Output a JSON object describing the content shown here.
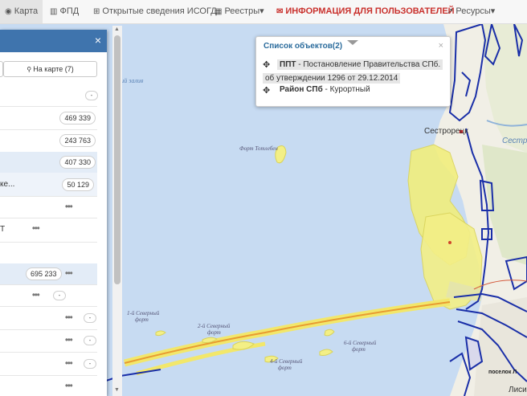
{
  "nav": {
    "items": [
      {
        "label": "Карта",
        "icon": "globe-icon",
        "active": true
      },
      {
        "label": "ФПД",
        "icon": "map-book-icon"
      },
      {
        "label": "Открытые сведения ИСОГД",
        "icon": "square-plus-icon"
      },
      {
        "label": "Реестры",
        "icon": "table-icon",
        "caret": "▾"
      },
      {
        "label": "ИНФОРМАЦИЯ ДЛЯ ПОЛЬЗОВАТЕЛЕЙ",
        "icon": "chat-icon",
        "alert": true
      },
      {
        "label": "Ресурсы",
        "icon": "external-link-icon",
        "caret": "▾"
      }
    ]
  },
  "panel": {
    "close": "×",
    "tab_map": "На карте (7)",
    "rows": [
      {
        "label": "",
        "count": "",
        "mini": "-"
      },
      {
        "label": "",
        "count": "469 339"
      },
      {
        "label": "",
        "count": "243 763"
      },
      {
        "label": "",
        "count": "407 330",
        "highlight": true
      },
      {
        "label": "ке...",
        "count": "50 129",
        "highlight": true
      },
      {
        "label": "",
        "dots": "•••"
      },
      {
        "label": "Т",
        "dots": "•••"
      },
      {
        "label": "",
        "count": ""
      },
      {
        "label": "",
        "count": "695 233",
        "dots": "•••",
        "highlight": true
      },
      {
        "label": "",
        "dots": "•••",
        "mini": "-"
      },
      {
        "label": "",
        "dots": "•••",
        "mini": "-"
      },
      {
        "label": "",
        "dots": "•••",
        "mini": "-"
      },
      {
        "label": "",
        "dots": "•••",
        "mini": "-"
      },
      {
        "label": "",
        "dots": "•••"
      }
    ]
  },
  "popup": {
    "title": "Список объектов(2)",
    "close": "×",
    "item1_bold": "ППТ",
    "item1_text": " - Постановление Правительства СПб.",
    "item1_text2": "об утверждении 1296 от 29.12.2014",
    "item2_bold": "Район СПб",
    "item2_text": " - Курортный"
  },
  "map": {
    "labels": {
      "bay": "ский залив",
      "fort_totleben": "Форт Тотлебен",
      "fort1": "1-й Северный",
      "fort1b": "форт",
      "fort2": "2-й Северный",
      "fort2b": "форт",
      "fort4": "4-й Северный",
      "fort4b": "форт",
      "fort6": "6-й Северный",
      "fort6b": "форт",
      "city": "Сестрорецк",
      "city2": "Сестро",
      "village": "поселок Л",
      "lisi": "Лиси"
    }
  }
}
